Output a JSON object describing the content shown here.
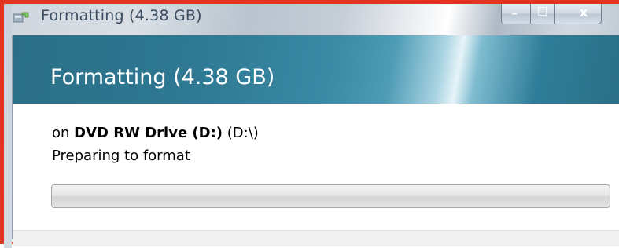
{
  "window": {
    "title": "Formatting (4.38 GB)"
  },
  "caption_buttons": {
    "minimize": "–",
    "maximize": "□",
    "close": "x"
  },
  "dialog": {
    "heading": "Formatting (4.38 GB)",
    "on_prefix": "on",
    "drive_name": "DVD RW Drive (D:)",
    "drive_path": "(D:\\)",
    "status": "Preparing to format",
    "progress_fraction": 0.0
  },
  "colors": {
    "frame_border": "#e2341e",
    "header_band": "#2e7893",
    "progress_fill": "#36c136"
  },
  "icons": {
    "app": "format-drive-icon"
  }
}
